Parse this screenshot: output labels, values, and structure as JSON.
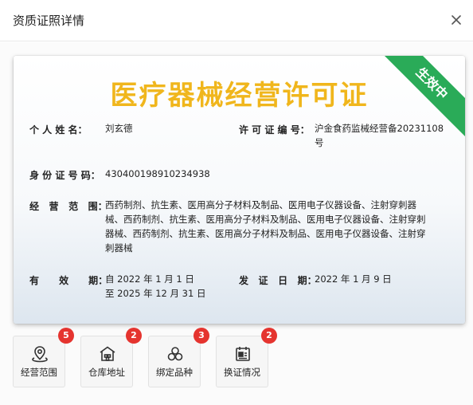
{
  "dialog": {
    "title": "资质证照详情"
  },
  "certificate": {
    "title": "医疗器械经营许可证",
    "status_ribbon": "生效中",
    "status_color": "#2aab58",
    "title_color": "#f0b61c",
    "fields": {
      "name_label": "个 人 姓 名：",
      "name_value": "刘玄德",
      "license_no_label": "许 可 证 编 号：",
      "license_no_value_line1": "沪金食药监械经营备20231108",
      "license_no_value_line2": "号",
      "id_label": "身 份 证 号 码：",
      "id_value": "430400198910234938",
      "scope_label": "经   营   范   围：",
      "scope_value_lines": [
        "西药制剂、抗生素、医用高分子材料及制品、医用电子仪器设备、注射穿刺器",
        "械、西药制剂、抗生素、医用高分子材料及制品、医用电子仪器设备、注射穿刺",
        "器械、西药制剂、抗生素、医用高分子材料及制品、医用电子仪器设备、注射穿",
        "刺器械"
      ],
      "valid_label": "有      效      期：",
      "valid_from": "自 2022 年 1 月 1 日",
      "valid_to": "至 2025 年 12 月 31 日",
      "issue_label": "发   证   日   期：",
      "issue_value": "2022 年 1 月 9 日"
    }
  },
  "actions": [
    {
      "label": "经营范围",
      "badge": "5",
      "icon": "map-pin-icon"
    },
    {
      "label": "仓库地址",
      "badge": "2",
      "icon": "warehouse-icon"
    },
    {
      "label": "绑定品种",
      "badge": "3",
      "icon": "circles-icon"
    },
    {
      "label": "换证情况",
      "badge": "2",
      "icon": "certificate-swap-icon"
    }
  ],
  "badge_color": "#e5342f"
}
